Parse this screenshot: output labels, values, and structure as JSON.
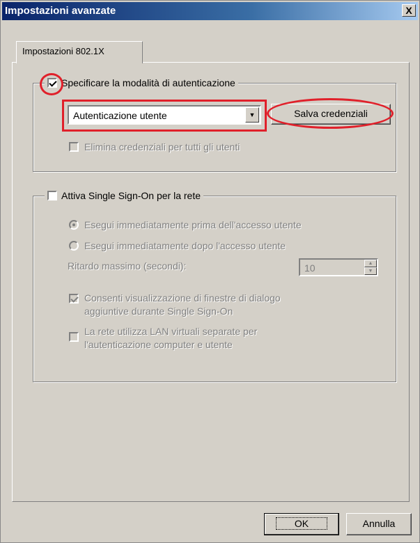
{
  "window": {
    "title": "Impostazioni avanzate",
    "close_glyph": "X"
  },
  "tab": {
    "label": "Impostazioni 802.1X"
  },
  "auth_group": {
    "checkbox_label": "Specificare la modalità di autenticazione",
    "checkbox_checked": true,
    "dropdown_value": "Autenticazione utente",
    "save_credentials_label": "Salva credenziali",
    "delete_credentials_label": "Elimina credenziali per tutti gli utenti",
    "delete_credentials_checked": false
  },
  "sso_group": {
    "checkbox_label": "Attiva Single Sign-On per la rete",
    "checkbox_checked": false,
    "radio_before_label": "Esegui immediatamente prima dell'accesso utente",
    "radio_after_label": "Esegui immediatamente dopo l'accesso utente",
    "selected_radio": "before",
    "max_delay_label": "Ritardo massimo (secondi):",
    "max_delay_value": "10",
    "allow_dialogs_label_line1": "Consenti visualizzazione di finestre di dialogo",
    "allow_dialogs_label_line2": "aggiuntive durante Single Sign-On",
    "allow_dialogs_checked": true,
    "vlan_label_line1": "La rete utilizza LAN virtuali separate per",
    "vlan_label_line2": "l'autenticazione computer e utente",
    "vlan_checked": false
  },
  "footer": {
    "ok_label": "OK",
    "cancel_label": "Annulla"
  },
  "annotation_color": "#e0202a"
}
